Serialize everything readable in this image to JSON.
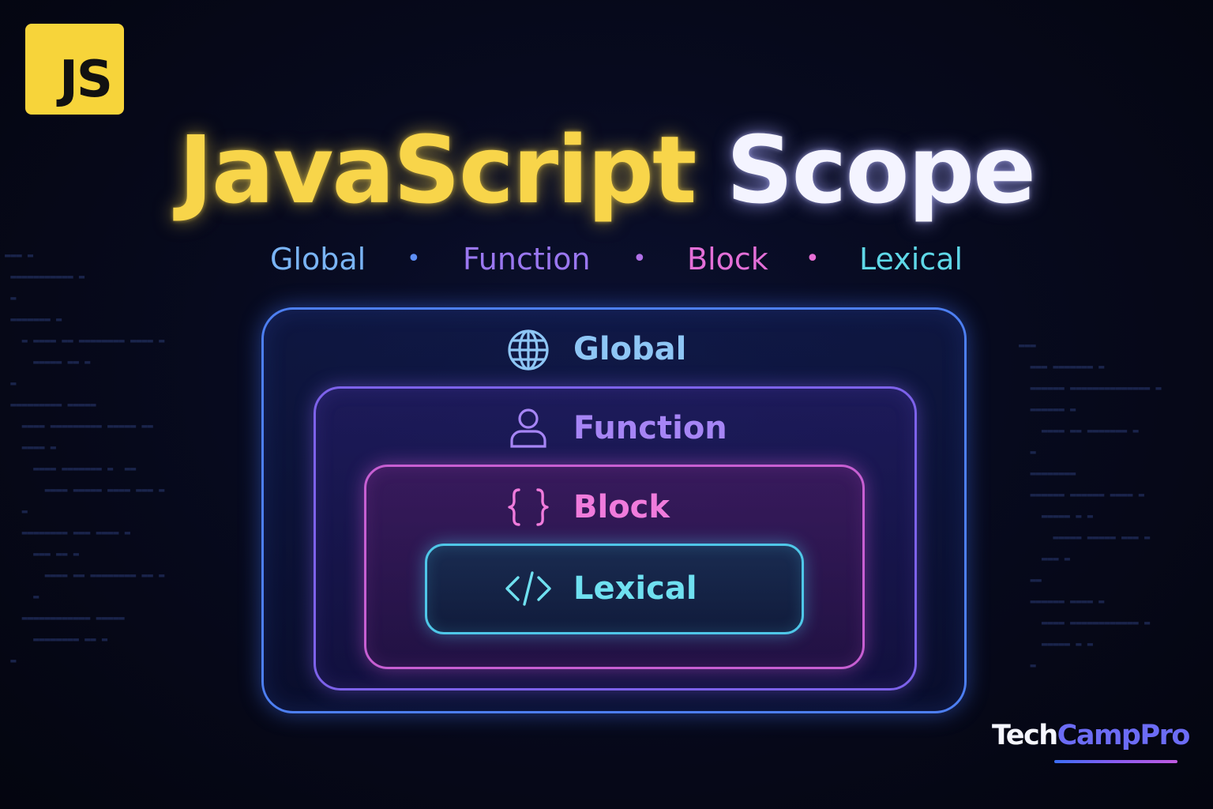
{
  "logo": {
    "text": "JS"
  },
  "title": {
    "part1": "JavaScript",
    "part2": "Scope"
  },
  "subtitle": {
    "items": [
      {
        "label": "Global",
        "color": "#7ab4f5"
      },
      {
        "label": "Function",
        "color": "#9a77f0"
      },
      {
        "label": "Block",
        "color": "#e46fd8"
      },
      {
        "label": "Lexical",
        "color": "#5fd8e8"
      }
    ],
    "separator": "•",
    "separator_colors": [
      "#5e8ff5",
      "#b070e8",
      "#e86fd6"
    ]
  },
  "scopes": {
    "global": {
      "label": "Global",
      "icon": "globe-icon",
      "color": "#8ec6f5"
    },
    "function": {
      "label": "Function",
      "icon": "user-icon",
      "color": "#a685f5"
    },
    "block": {
      "label": "Block",
      "icon": "curly-braces-icon",
      "color": "#f07bdc"
    },
    "lexical": {
      "label": "Lexical",
      "icon": "code-tag-icon",
      "color": "#6fe0f0"
    }
  },
  "brand": {
    "part1": "Tech",
    "part2": "CampPro"
  }
}
